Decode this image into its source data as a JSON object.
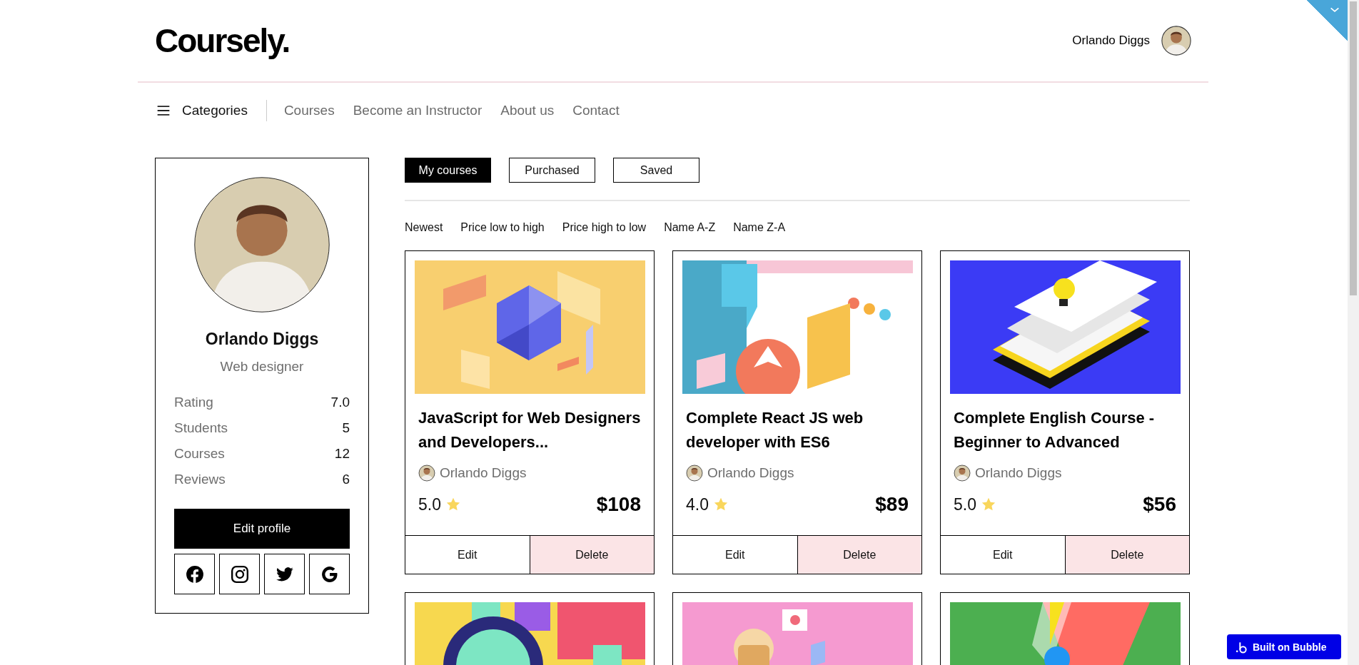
{
  "header": {
    "logo": "Coursely.",
    "user_name": "Orlando Diggs"
  },
  "nav": {
    "categories": "Categories",
    "links": [
      "Courses",
      "Become an Instructor",
      "About us",
      "Contact"
    ]
  },
  "profile": {
    "name": "Orlando Diggs",
    "role": "Web designer",
    "stats": [
      {
        "label": "Rating",
        "value": "7.0"
      },
      {
        "label": "Students",
        "value": "5"
      },
      {
        "label": "Courses",
        "value": "12"
      },
      {
        "label": "Reviews",
        "value": "6"
      }
    ],
    "edit_button": "Edit profile",
    "socials": [
      {
        "kind": "facebook"
      },
      {
        "kind": "instagram"
      },
      {
        "kind": "twitter"
      },
      {
        "kind": "google"
      }
    ]
  },
  "tabs": [
    {
      "label": "My courses",
      "selected": true
    },
    {
      "label": "Purchased",
      "selected": false
    },
    {
      "label": "Saved",
      "selected": false
    }
  ],
  "sort_options": [
    "Newest",
    "Price low to high",
    "Price high to low",
    "Name A-Z",
    "Name Z-A"
  ],
  "courses": [
    {
      "kind": "picture",
      "title": "JavaScript for Web Designers and Developers...",
      "author": "Orlando Diggs",
      "rating": "5.0",
      "price": "$108",
      "edit": "Edit",
      "delete": "Delete"
    },
    {
      "kind": "picture",
      "title": "Complete React JS web developer with ES6",
      "author": "Orlando Diggs",
      "rating": "4.0",
      "price": "$89",
      "edit": "Edit",
      "delete": "Delete"
    },
    {
      "kind": "picture",
      "title": "Complete English Course - Beginner to Advanced",
      "author": "Orlando Diggs",
      "rating": "5.0",
      "price": "$56",
      "edit": "Edit",
      "delete": "Delete"
    },
    {
      "kind": "picture"
    },
    {
      "kind": "picture"
    },
    {
      "kind": "picture"
    }
  ],
  "badge": "Built on Bubble"
}
